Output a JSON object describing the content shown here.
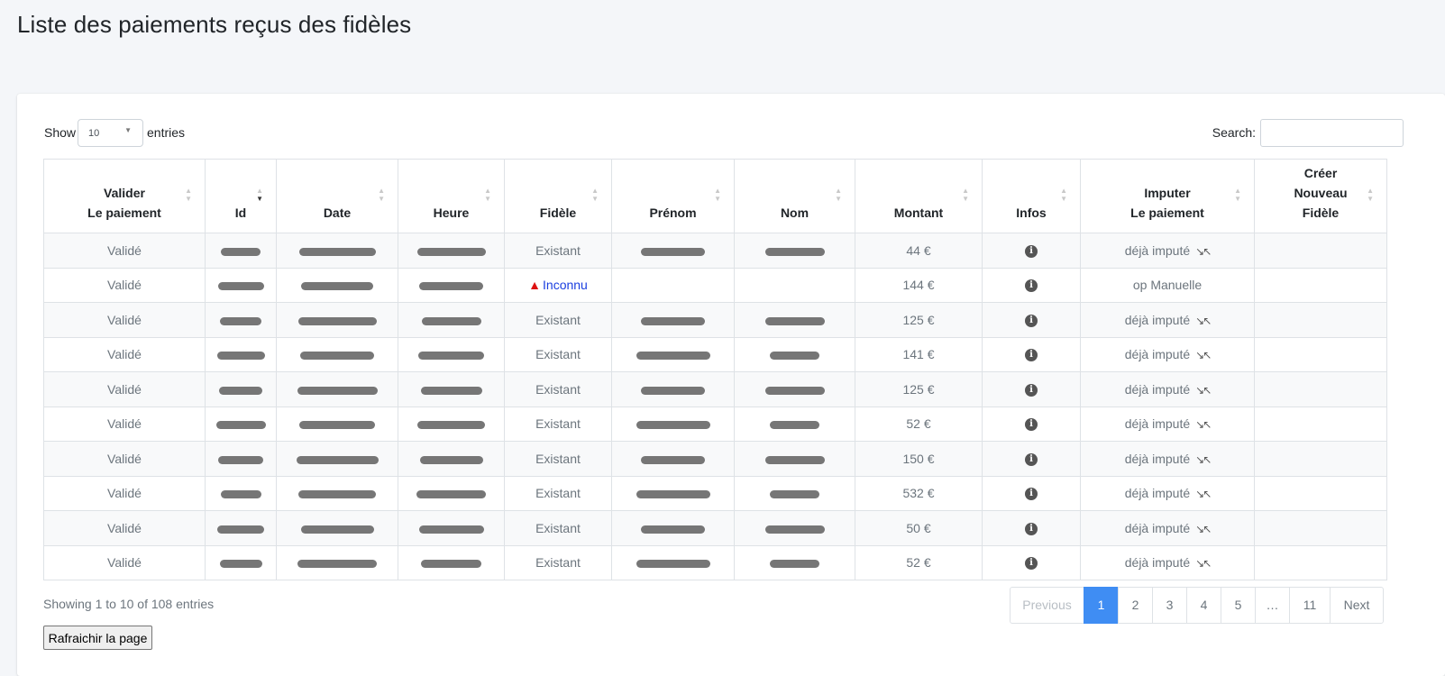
{
  "title": "Liste des paiements reçus des fidèles",
  "length": {
    "show_label": "Show",
    "value": "10",
    "entries_label": "entries"
  },
  "search": {
    "label": "Search:",
    "value": ""
  },
  "columns": [
    {
      "l1": "Valider",
      "l2": "Le paiement"
    },
    {
      "l1": "",
      "l2": "Id",
      "sorted": true
    },
    {
      "l1": "",
      "l2": "Date"
    },
    {
      "l1": "",
      "l2": "Heure"
    },
    {
      "l1": "",
      "l2": "Fidèle"
    },
    {
      "l1": "",
      "l2": "Prénom"
    },
    {
      "l1": "",
      "l2": "Nom"
    },
    {
      "l1": "",
      "l2": "Montant"
    },
    {
      "l1": "",
      "l2": "Infos"
    },
    {
      "l1": "Imputer",
      "l2": "Le paiement"
    },
    {
      "l0": "Créer",
      "l1": "Nouveau",
      "l2": "Fidèle"
    }
  ],
  "rows": [
    {
      "status": "Validé",
      "fidele": "Existant",
      "montant": "44 €",
      "imputer": "déjà imputé",
      "redacted": [
        1,
        1,
        1,
        1,
        1
      ]
    },
    {
      "status": "Validé",
      "fidele": "Inconnu",
      "montant": "144 €",
      "imputer": "op Manuelle",
      "redacted": [
        1,
        1,
        1,
        0,
        0
      ]
    },
    {
      "status": "Validé",
      "fidele": "Existant",
      "montant": "125 €",
      "imputer": "déjà imputé",
      "redacted": [
        1,
        1,
        1,
        1,
        1
      ]
    },
    {
      "status": "Validé",
      "fidele": "Existant",
      "montant": "141 €",
      "imputer": "déjà imputé",
      "redacted": [
        1,
        1,
        1,
        1,
        1
      ]
    },
    {
      "status": "Validé",
      "fidele": "Existant",
      "montant": "125 €",
      "imputer": "déjà imputé",
      "redacted": [
        1,
        1,
        1,
        1,
        1
      ]
    },
    {
      "status": "Validé",
      "fidele": "Existant",
      "montant": "52 €",
      "imputer": "déjà imputé",
      "redacted": [
        1,
        1,
        1,
        1,
        1
      ]
    },
    {
      "status": "Validé",
      "fidele": "Existant",
      "montant": "150 €",
      "imputer": "déjà imputé",
      "redacted": [
        1,
        1,
        1,
        1,
        1
      ]
    },
    {
      "status": "Validé",
      "fidele": "Existant",
      "montant": "532 €",
      "imputer": "déjà imputé",
      "redacted": [
        1,
        1,
        1,
        1,
        1
      ]
    },
    {
      "status": "Validé",
      "fidele": "Existant",
      "montant": "50 €",
      "imputer": "déjà imputé",
      "redacted": [
        1,
        1,
        1,
        1,
        1
      ]
    },
    {
      "status": "Validé",
      "fidele": "Existant",
      "montant": "52 €",
      "imputer": "déjà imputé",
      "redacted": [
        1,
        1,
        1,
        1,
        1
      ]
    }
  ],
  "footer": {
    "info": "Showing 1 to 10 of 108 entries"
  },
  "pagination": [
    "Previous",
    "1",
    "2",
    "3",
    "4",
    "5",
    "…",
    "11",
    "Next"
  ],
  "refresh_label": "Rafraichir la page",
  "colors": {
    "active_page": "#3f8df3",
    "warning": "#dd1111",
    "link": "#1a3ee0"
  }
}
